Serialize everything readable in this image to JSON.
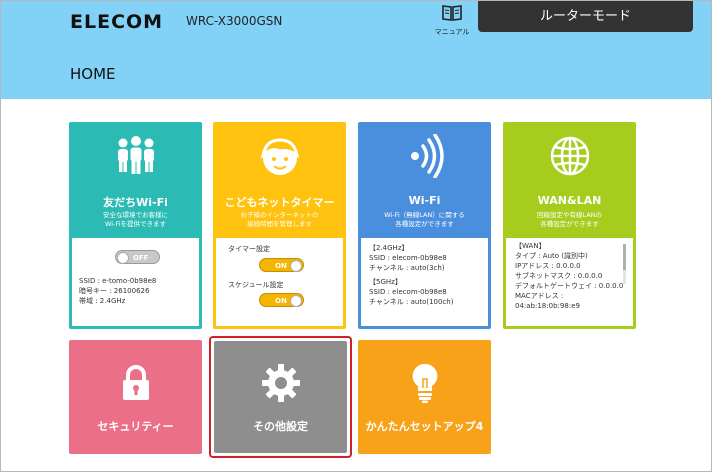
{
  "header": {
    "logo": "ELECOM",
    "model": "WRC-X3000GSN",
    "manual_label": "マニュアル",
    "mode_button": "ルーターモード",
    "page_title": "HOME"
  },
  "colors": {
    "header_bg": "#82d2f8",
    "friends": "#2bbbb4",
    "kids": "#ffc20e",
    "wifi": "#4a8fde",
    "wan": "#a6cc1e",
    "security": "#ec6f88",
    "other": "#8e8e8e",
    "setup": "#f8a21a",
    "selected_outline": "#d0202a"
  },
  "cards": {
    "friends": {
      "icon": "people-icon",
      "title": "友だちWi-Fi",
      "desc1": "安全な環境でお客様に",
      "desc2": "Wi-Fiを提供できます",
      "toggle_label": "OFF",
      "ssid": "SSID : e-tomo-0b98e8",
      "key": "暗号キー : 26100626",
      "band": "帯域 : 2.4GHz"
    },
    "kids": {
      "icon": "child-face-icon",
      "title": "こどもネットタイマー",
      "desc1": "お子様のインターネットの",
      "desc2": "接続時間を管理します",
      "timer_label": "タイマー設定",
      "timer_toggle": "ON",
      "schedule_label": "スケジュール設定",
      "schedule_toggle": "ON"
    },
    "wifi": {
      "icon": "wifi-signal-icon",
      "title": "Wi-Fi",
      "desc1": "Wi-Fi（無線LAN）に関する",
      "desc2": "各種設定ができます",
      "band24": "【2.4GHz】",
      "ssid24": "SSID : elecom-0b98e8",
      "ch24": "チャンネル : auto(3ch)",
      "band5": "【5GHz】",
      "ssid5": "SSID : elecom-0b98e8",
      "ch5": "チャンネル : auto(100ch)"
    },
    "wan": {
      "icon": "globe-icon",
      "title": "WAN&LAN",
      "desc1": "回線設定や有線LANの",
      "desc2": "各種設定ができます",
      "header": "【WAN】",
      "type": "タイプ : Auto (識別中)",
      "ip": "IPアドレス : 0.0.0.0",
      "mask": "サブネットマスク : 0.0.0.0",
      "gateway": "デフォルトゲートウェイ : 0.0.0.0",
      "mac_label": "MACアドレス :",
      "mac": "04:ab:18:0b:98:e9"
    },
    "security": {
      "icon": "lock-icon",
      "title": "セキュリティー"
    },
    "other": {
      "icon": "gear-icon",
      "title": "その他設定"
    },
    "setup": {
      "icon": "lightbulb-icon",
      "title": "かんたんセットアップ4"
    }
  }
}
